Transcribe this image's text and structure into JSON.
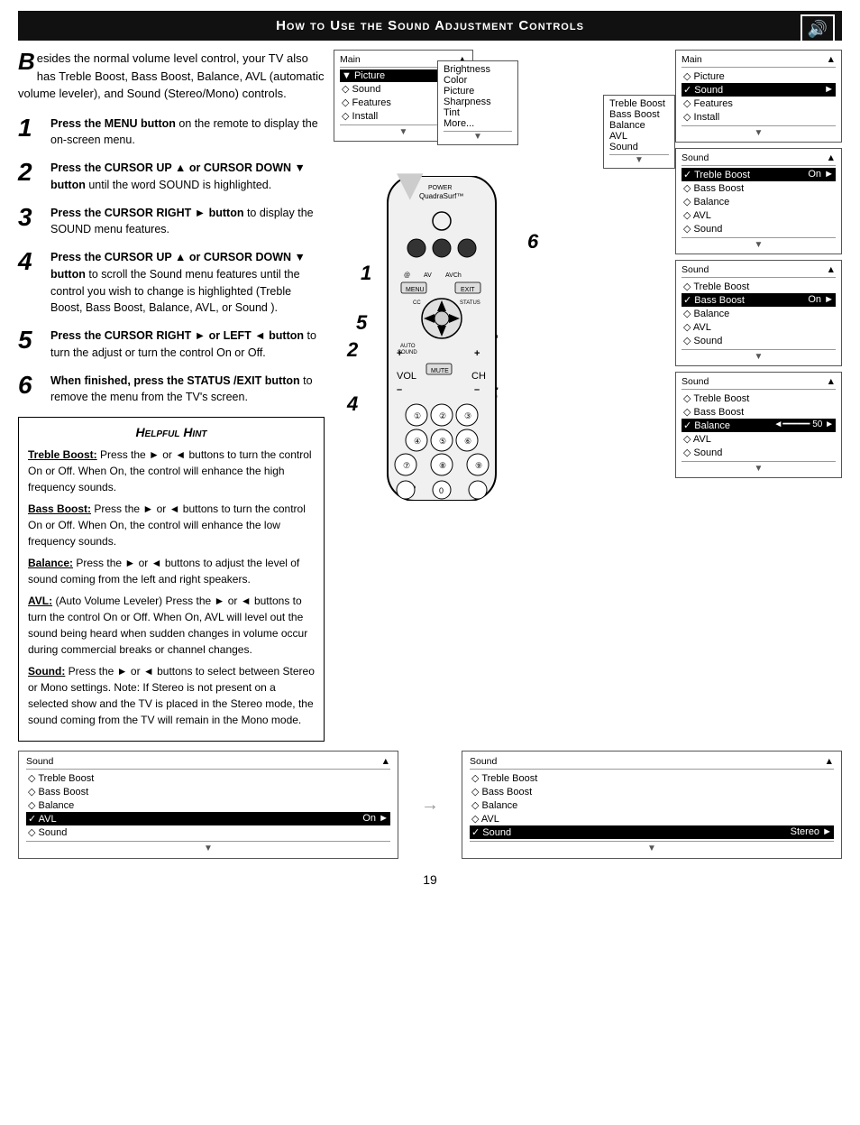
{
  "header": {
    "title": "How to Use the Sound Adjustment Controls",
    "icon": "🔊"
  },
  "intro": {
    "big_letter": "B",
    "text": "esides the normal volume level control, your TV also has Treble Boost, Bass Boost, Balance, AVL (automatic volume leveler), and Sound (Stereo/Mono) controls."
  },
  "steps": [
    {
      "num": "1",
      "text_bold": "Press the MENU button",
      "text": " on the remote to display the on-screen menu."
    },
    {
      "num": "2",
      "text_bold": "Press the CURSOR UP ▲ or CURSOR DOWN ▼ button",
      "text": " until the word SOUND is highlighted."
    },
    {
      "num": "3",
      "text_bold": "Press the CURSOR RIGHT ► button",
      "text": " to display the SOUND menu features."
    },
    {
      "num": "4",
      "text_bold": "Press the CURSOR UP ▲ or CURSOR DOWN ▼ button",
      "text": " to scroll the Sound menu features until the control you wish to change is highlighted (Treble Boost, Bass Boost, Balance, AVL, or Sound )."
    },
    {
      "num": "5",
      "text_bold": "Press the CURSOR RIGHT ► or LEFT ◄ button",
      "text": " to turn the adjust or turn the control On or Off."
    },
    {
      "num": "6",
      "text_bold": "When finished, press the STATUS /EXIT button",
      "text": " to remove the menu from the TV's screen."
    }
  ],
  "hint": {
    "title": "Helpful Hint",
    "items": [
      {
        "label": "Treble Boost:",
        "text": " Press the ► or ◄ buttons to turn the control On or Off. When On, the control will enhance the high frequency sounds."
      },
      {
        "label": "Bass Boost:",
        "text": " Press the ► or ◄ buttons to turn the control On or Off. When On, the control will enhance the low frequency sounds."
      },
      {
        "label": "Balance:",
        "text": " Press the ► or ◄ buttons to adjust the level of sound coming from the left and right speakers."
      },
      {
        "label": "AVL:",
        "text": " (Auto Volume Leveler) Press the ► or ◄ buttons to turn the control On or Off. When On, AVL will level out the sound being heard when sudden changes in volume occur during commercial breaks or channel changes."
      },
      {
        "label": "Sound:",
        "text": " Press the ► or ◄ buttons to select between Stereo or Mono settings. Note: If Stereo is not present on a selected show and the TV is placed in the Stereo mode, the sound coming from the TV will remain in the Mono mode."
      }
    ]
  },
  "menu1": {
    "title": "Main",
    "arrow": "▲",
    "rows": [
      {
        "label": "▼ Picture",
        "value": "►",
        "selected": false
      },
      {
        "label": "◇ Sound",
        "value": "",
        "selected": false
      },
      {
        "label": "◇ Features",
        "value": "",
        "selected": false
      },
      {
        "label": "◇ Install",
        "value": "",
        "selected": false
      }
    ],
    "sub_items": [
      "Brightness",
      "Color",
      "Picture",
      "Sharpness",
      "Tint",
      "More..."
    ]
  },
  "menu2": {
    "title": "Main",
    "arrow": "▲",
    "rows": [
      {
        "label": "◇ Picture",
        "value": "",
        "selected": false
      },
      {
        "label": "✓ Sound",
        "value": "►",
        "selected": true
      },
      {
        "label": "◇ Features",
        "value": "",
        "selected": false
      },
      {
        "label": "◇ Install",
        "value": "",
        "selected": false
      }
    ],
    "sub_items": [
      "Treble Boost",
      "Bass Boost",
      "Balance",
      "AVL",
      "Sound"
    ]
  },
  "menu3": {
    "title": "Sound",
    "arrow": "▲",
    "rows": [
      {
        "label": "✓ Treble Boost",
        "value": "On ►",
        "selected": true
      },
      {
        "label": "◇ Bass Boost",
        "value": "",
        "selected": false
      },
      {
        "label": "◇ Balance",
        "value": "",
        "selected": false
      },
      {
        "label": "◇ AVL",
        "value": "",
        "selected": false
      },
      {
        "label": "◇ Sound",
        "value": "",
        "selected": false
      }
    ]
  },
  "menu4": {
    "title": "Sound",
    "arrow": "▲",
    "rows": [
      {
        "label": "◇ Treble Boost",
        "value": "",
        "selected": false
      },
      {
        "label": "✓ Bass Boost",
        "value": "On ►",
        "selected": true
      },
      {
        "label": "◇ Balance",
        "value": "",
        "selected": false
      },
      {
        "label": "◇ AVL",
        "value": "",
        "selected": false
      },
      {
        "label": "◇ Sound",
        "value": "",
        "selected": false
      }
    ]
  },
  "menu5": {
    "title": "Sound",
    "arrow": "▲",
    "rows": [
      {
        "label": "◇ Treble Boost",
        "value": "",
        "selected": false
      },
      {
        "label": "◇ Bass Boost",
        "value": "",
        "selected": false
      },
      {
        "label": "✓ Balance",
        "value": "◄━━━━━━ 50 ►",
        "selected": true
      },
      {
        "label": "◇ AVL",
        "value": "",
        "selected": false
      },
      {
        "label": "◇ Sound",
        "value": "",
        "selected": false
      }
    ]
  },
  "menu6": {
    "title": "Sound",
    "arrow": "▲",
    "rows": [
      {
        "label": "◇ Treble Boost",
        "value": "",
        "selected": false
      },
      {
        "label": "◇ Bass Boost",
        "value": "",
        "selected": false
      },
      {
        "label": "◇ Balance",
        "value": "",
        "selected": false
      },
      {
        "label": "✓ AVL",
        "value": "On ►",
        "selected": true
      },
      {
        "label": "◇ Sound",
        "value": "",
        "selected": false
      }
    ]
  },
  "menu7": {
    "title": "Sound",
    "arrow": "▲",
    "rows": [
      {
        "label": "◇ Treble Boost",
        "value": "",
        "selected": false
      },
      {
        "label": "◇ Bass Boost",
        "value": "",
        "selected": false
      },
      {
        "label": "◇ Balance",
        "value": "",
        "selected": false
      },
      {
        "label": "◇ AVL",
        "value": "",
        "selected": false
      },
      {
        "label": "✓ Sound",
        "value": "Stereo ►",
        "selected": true
      }
    ]
  },
  "page_number": "19",
  "diagram_labels": {
    "label1": "1",
    "label2": "2",
    "label3": "3",
    "label4": "4",
    "label5": "5",
    "label6": "6",
    "label2b": "2",
    "label4b": "4"
  }
}
